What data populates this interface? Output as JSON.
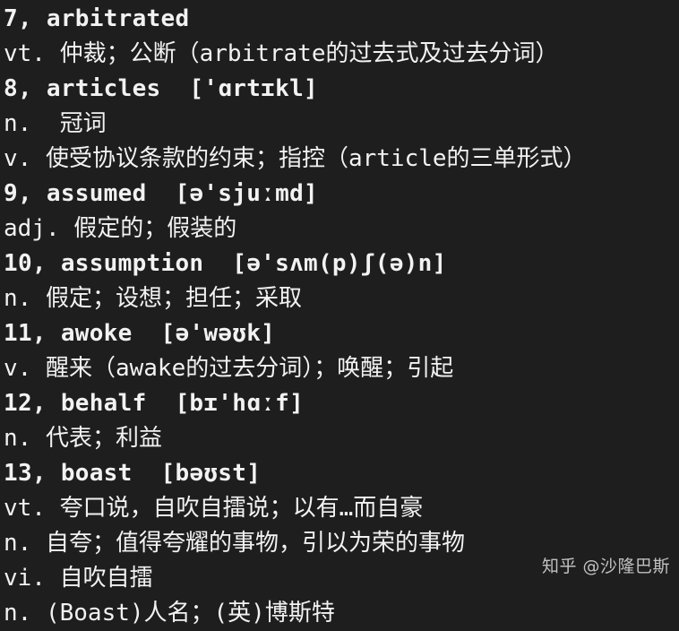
{
  "document": {
    "background_color": "#1e1e1e",
    "text_color": "#f2f2f2",
    "watermark_color": "#cfcfcf",
    "lines": [
      {
        "text": "7, arbitrated",
        "kind": "headword"
      },
      {
        "text": "vt. 仲裁；公断（arbitrate的过去式及过去分词）",
        "kind": "pos"
      },
      {
        "text": "8, articles  ['ɑrtɪkl]",
        "kind": "headword"
      },
      {
        "text": "n.  冠词",
        "kind": "pos"
      },
      {
        "text": "v. 使受协议条款的约束；指控（article的三单形式）",
        "kind": "pos"
      },
      {
        "text": "9, assumed  [ə'sjuːmd]",
        "kind": "headword"
      },
      {
        "text": "adj. 假定的；假装的",
        "kind": "pos"
      },
      {
        "text": "10, assumption  [ə'sʌm(p)ʃ(ə)n]",
        "kind": "headword"
      },
      {
        "text": "n. 假定；设想；担任；采取",
        "kind": "pos"
      },
      {
        "text": "11, awoke  [ə'wəʊk]",
        "kind": "headword"
      },
      {
        "text": "v. 醒来（awake的过去分词）；唤醒；引起",
        "kind": "pos"
      },
      {
        "text": "12, behalf  [bɪ'hɑːf]",
        "kind": "headword"
      },
      {
        "text": "n. 代表；利益",
        "kind": "pos"
      },
      {
        "text": "13, boast  [bəʊst]",
        "kind": "headword"
      },
      {
        "text": "vt. 夸口说，自吹自擂说；以有…而自豪",
        "kind": "pos"
      },
      {
        "text": "n. 自夸；值得夸耀的事物，引以为荣的事物",
        "kind": "pos"
      },
      {
        "text": "vi. 自吹自擂",
        "kind": "pos"
      },
      {
        "text": "n. (Boast)人名；(英)博斯特",
        "kind": "pos"
      }
    ],
    "watermark": "知乎 @沙隆巴斯"
  }
}
